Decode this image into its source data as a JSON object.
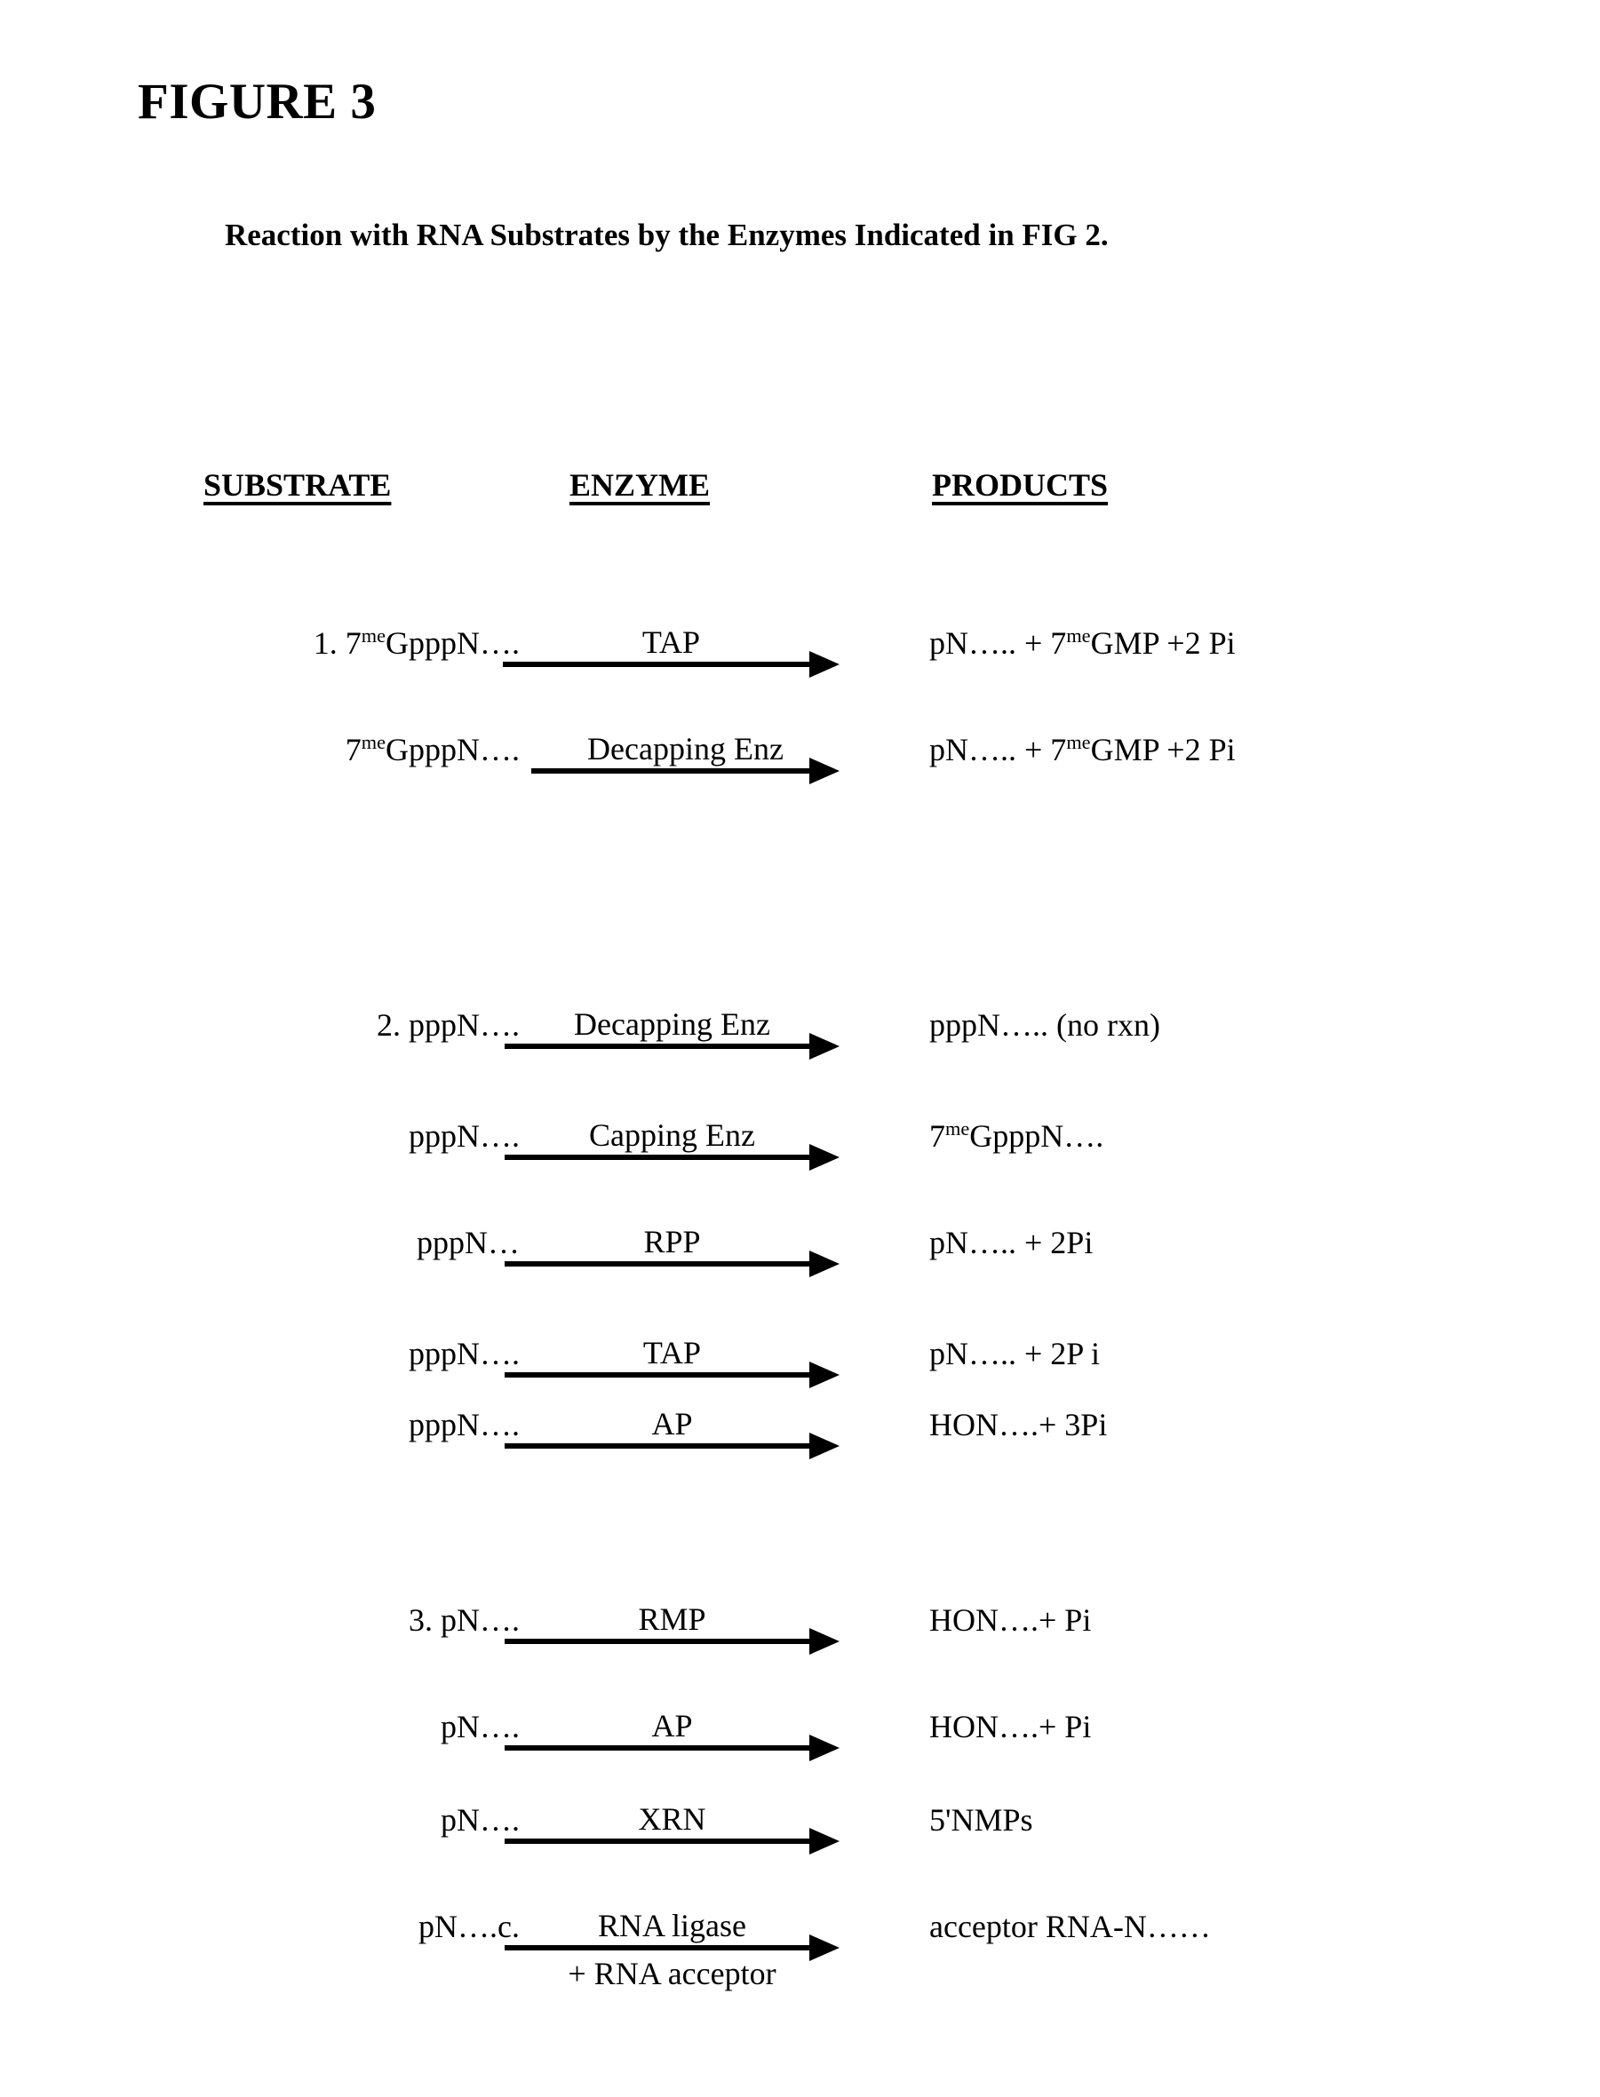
{
  "title": "FIGURE 3",
  "subtitle": "Reaction with RNA Substrates by the Enzymes Indicated in FIG 2.",
  "columns": {
    "substrate": "SUBSTRATE",
    "enzyme": "ENZYME",
    "products": "PRODUCTS"
  },
  "reactions": [
    {
      "substrate_pre": "1. 7",
      "substrate_sup": "me",
      "substrate_post": "GpppN….",
      "enzyme": "TAP",
      "enzyme_second_line": "",
      "product_pre": "pN….. +  7",
      "product_sup": "me",
      "product_post": "GMP +2 Pi"
    },
    {
      "substrate_pre": "7",
      "substrate_sup": "me",
      "substrate_post": "GpppN….",
      "enzyme": "Decapping Enz",
      "enzyme_second_line": "",
      "product_pre": "pN….. +  7",
      "product_sup": "me",
      "product_post": "GMP +2 Pi"
    },
    {
      "substrate_pre": "2.  pppN….",
      "substrate_sup": "",
      "substrate_post": "",
      "enzyme": "Decapping Enz",
      "enzyme_second_line": "",
      "product_pre": "pppN…..   (no rxn)",
      "product_sup": "",
      "product_post": ""
    },
    {
      "substrate_pre": "pppN….",
      "substrate_sup": "",
      "substrate_post": "",
      "enzyme": "Capping Enz",
      "enzyme_second_line": "",
      "product_pre": "7",
      "product_sup": "me",
      "product_post": "GpppN…."
    },
    {
      "substrate_pre": "pppN…",
      "substrate_sup": "",
      "substrate_post": "",
      "enzyme": "RPP",
      "enzyme_second_line": "",
      "product_pre": "pN….. + 2Pi",
      "product_sup": "",
      "product_post": ""
    },
    {
      "substrate_pre": "pppN….",
      "substrate_sup": "",
      "substrate_post": "",
      "enzyme": "TAP",
      "enzyme_second_line": "",
      "product_pre": "pN….. + 2P i",
      "product_sup": "",
      "product_post": ""
    },
    {
      "substrate_pre": "pppN….",
      "substrate_sup": "",
      "substrate_post": "",
      "enzyme": "AP",
      "enzyme_second_line": "",
      "product_pre": "HON….+ 3Pi",
      "product_sup": "",
      "product_post": ""
    },
    {
      "substrate_pre": "3.  pN….",
      "substrate_sup": "",
      "substrate_post": "",
      "enzyme": "RMP",
      "enzyme_second_line": "",
      "product_pre": "HON….+ Pi",
      "product_sup": "",
      "product_post": ""
    },
    {
      "substrate_pre": "pN….",
      "substrate_sup": "",
      "substrate_post": "",
      "enzyme": "AP",
      "enzyme_second_line": "",
      "product_pre": "HON….+ Pi",
      "product_sup": "",
      "product_post": ""
    },
    {
      "substrate_pre": "pN….",
      "substrate_sup": "",
      "substrate_post": "",
      "enzyme": "XRN",
      "enzyme_second_line": "",
      "product_pre": "5'NMPs",
      "product_sup": "",
      "product_post": ""
    },
    {
      "substrate_pre": "pN….c.",
      "substrate_sup": "",
      "substrate_post": "",
      "enzyme": "RNA ligase",
      "enzyme_second_line": "+ RNA acceptor",
      "product_pre": "acceptor RNA-N……",
      "product_sup": "",
      "product_post": ""
    }
  ],
  "colors": {
    "ink": "#000000",
    "paper": "#ffffff"
  }
}
